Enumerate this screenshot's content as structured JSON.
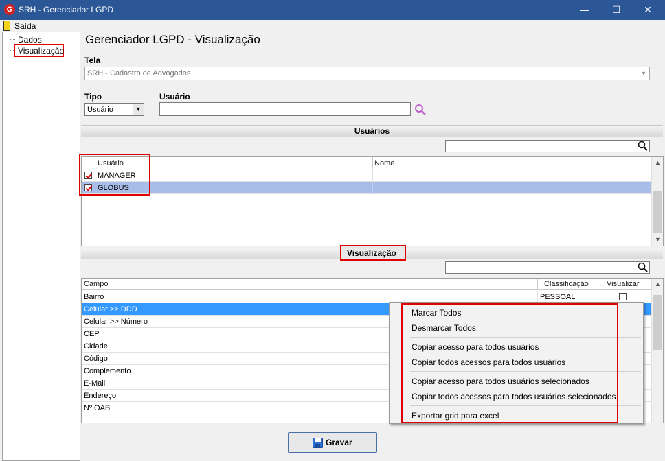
{
  "window": {
    "title": "SRH - Gerenciador LGPD",
    "logo": "G",
    "minimize": "—",
    "maximize": "☐",
    "close": "✕"
  },
  "menubar": {
    "exit_label": "Saída"
  },
  "sidebar": {
    "items": [
      {
        "label": "Dados"
      },
      {
        "label": "Visualização"
      }
    ]
  },
  "page": {
    "title": "Gerenciador LGPD - Visualização"
  },
  "tela": {
    "label": "Tela",
    "value": "SRH - Cadastro de Advogados"
  },
  "tipo": {
    "label": "Tipo",
    "value": "Usuário"
  },
  "usuario": {
    "label": "Usuário",
    "value": ""
  },
  "users_section": {
    "title": "Usuários",
    "columns": [
      "Usuário",
      "Nome"
    ],
    "rows": [
      {
        "usuario": "MANAGER",
        "nome": "",
        "checked": true
      },
      {
        "usuario": "GLOBUS",
        "nome": "",
        "checked": true
      }
    ]
  },
  "view_section": {
    "title": "Visualização",
    "columns": [
      "Campo",
      "Classificação",
      "Visualizar"
    ],
    "rows": [
      {
        "campo": "Bairro",
        "classificacao": "PESSOAL",
        "visualizar": false
      },
      {
        "campo": "Celular >> DDD",
        "classificacao": "",
        "visualizar": false
      },
      {
        "campo": "Celular >> Número",
        "classificacao": "",
        "visualizar": false
      },
      {
        "campo": "CEP",
        "classificacao": "",
        "visualizar": false
      },
      {
        "campo": "Cidade",
        "classificacao": "",
        "visualizar": false
      },
      {
        "campo": "Código",
        "classificacao": "",
        "visualizar": false
      },
      {
        "campo": "Complemento",
        "classificacao": "",
        "visualizar": false
      },
      {
        "campo": "E-Mail",
        "classificacao": "",
        "visualizar": false
      },
      {
        "campo": "Endereço",
        "classificacao": "",
        "visualizar": false
      },
      {
        "campo": "Nº OAB",
        "classificacao": "",
        "visualizar": false
      }
    ]
  },
  "context_menu": {
    "items": [
      "Marcar Todos",
      "Desmarcar Todos",
      "Copiar acesso para todos usuários",
      "Copiar todos acessos para todos usuários",
      "Copiar acesso para todos usuários selecionados",
      "Copiar todos acessos para todos usuários selecionados",
      "Exportar grid para excel"
    ]
  },
  "footer": {
    "save_label": "Gravar"
  },
  "colors": {
    "titlebar": "#2b5797",
    "selection": "#3399ff",
    "highlight_row": "#a8bde8",
    "annotation": "#e00000"
  },
  "icons": {
    "exit": "exit-door-icon",
    "search": "magnifier-icon",
    "save": "floppy-disk-icon"
  }
}
